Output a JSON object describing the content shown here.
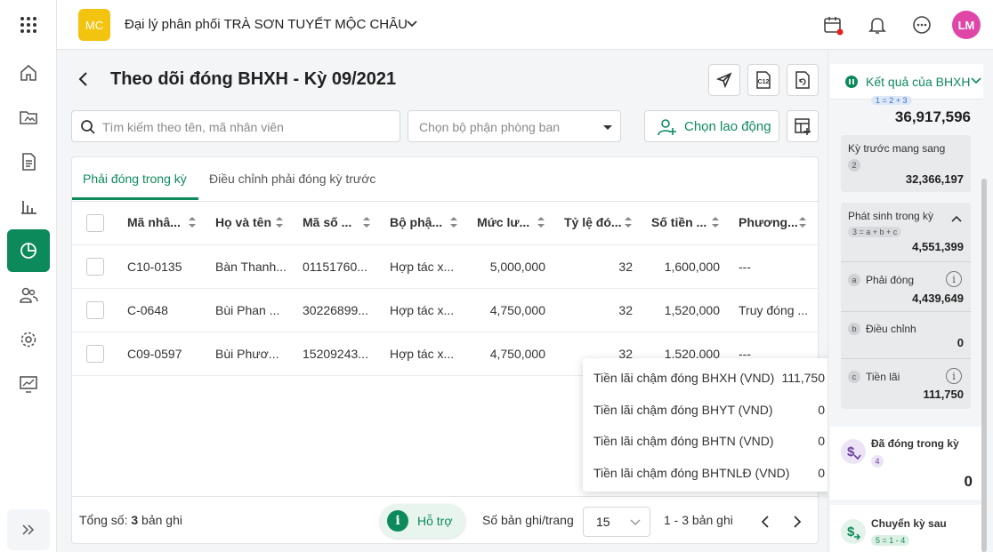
{
  "rail": {
    "items": [
      "apps-grid-icon",
      "home-icon",
      "folder-icon",
      "document-icon",
      "bar-chart-icon",
      "pie-chart-icon",
      "people-icon",
      "settings-icon",
      "monitor-chart-icon"
    ],
    "active": "pie-chart-icon",
    "expand_icon": "double-chevron-right-icon"
  },
  "topbar": {
    "logo_text": "MC",
    "company_name": "Đại lý phân phối TRÀ SƠN TUYẾT MỘC CHÂU",
    "avatar_text": "LM"
  },
  "page": {
    "title": "Theo dõi đóng BHXH - Kỳ 09/2021",
    "search_placeholder": "Tìm kiếm theo tên, mã nhân viên",
    "department_placeholder": "Chọn bộ phận phòng ban",
    "choose_employee_label": "Chọn lao động",
    "c12_label": "C12"
  },
  "tabs": [
    {
      "label": "Phải đóng trong kỳ",
      "active": true
    },
    {
      "label": "Điều chỉnh phải đóng kỳ trước",
      "active": false
    }
  ],
  "table": {
    "headers": [
      "Mã nhâ...",
      "Họ và tên",
      "Mã số ...",
      "Bộ phậ...",
      "Mức lư...",
      "Tỷ lệ đó...",
      "Số tiền ...",
      "Phương..."
    ],
    "rows": [
      [
        "C10-0135",
        "Bàn Thanh...",
        "01151760...",
        "Hợp tác x...",
        "5,000,000",
        "32",
        "1,600,000",
        "---"
      ],
      [
        "C-0648",
        "Bùi Phan ...",
        "30226899...",
        "Hợp tác x...",
        "4,750,000",
        "32",
        "1,520,000",
        "Truy đóng ..."
      ],
      [
        "C09-0597",
        "Bùi Phươ...",
        "15209243...",
        "Hợp tác x...",
        "4,750,000",
        "32",
        "1,520,000",
        "---"
      ]
    ]
  },
  "footer": {
    "total_prefix": "Tổng số: ",
    "total_count": "3",
    "total_suffix": " bản ghi",
    "support_label": "Hỗ trợ",
    "per_page_label": "Số bản ghi/trang",
    "per_page_value": "15",
    "range_label": "1 - 3 bản ghi"
  },
  "popup": {
    "rows": [
      {
        "label": "Tiền lãi chậm đóng BHXH (VND)",
        "value": "111,750"
      },
      {
        "label": "Tiền lãi chậm đóng BHYT (VND)",
        "value": "0"
      },
      {
        "label": "Tiền lãi chậm đóng BHTN (VND)",
        "value": "0"
      },
      {
        "label": "Tiền lãi chậm đóng BHTNLĐ (VND)",
        "value": "0"
      }
    ]
  },
  "right_panel": {
    "header": "Kết quả của BHXH",
    "top_formula": "1 = 2 + 3",
    "top_total": "36,917,596",
    "prev_label": "Kỳ trước mang sang",
    "prev_badge": "2",
    "prev_value": "32,366,197",
    "arise_label": "Phát sinh trong kỳ",
    "arise_formula": "3 = a + b + c",
    "arise_value": "4,551,399",
    "a_letter": "a",
    "a_label": "Phải đóng",
    "a_value": "4,439,649",
    "b_letter": "b",
    "b_label": "Điều chỉnh",
    "b_value": "0",
    "c_letter": "c",
    "c_label": "Tiền lãi",
    "c_value": "111,750",
    "paid_label": "Đã đóng trong kỳ",
    "paid_badge": "4",
    "paid_value": "0",
    "carry_label": "Chuyển kỳ sau",
    "carry_formula": "5 = 1 - 4"
  },
  "colors": {
    "primary": "#0d8a5b",
    "logo": "#f2c40f",
    "avatar": "#e046a8",
    "paid_icon": "#6b3fa0",
    "notification_dot": "#e0231c"
  }
}
